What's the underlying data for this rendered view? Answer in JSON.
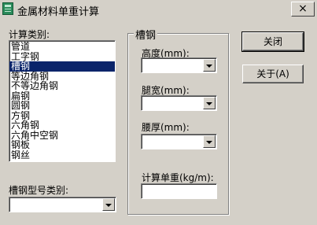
{
  "window": {
    "title": "金属材料单重计算",
    "close_glyph": "×"
  },
  "left": {
    "category_label": "计算类别:",
    "categories": [
      "管道",
      "工字钢",
      "槽钢",
      "等边角钢",
      "不等边角钢",
      "扁钢",
      "圆钢",
      "方钢",
      "六角钢",
      "六角中空钢",
      "钢板",
      "钢丝"
    ],
    "selected_category": "槽钢",
    "type_label": "槽钢型号类别:",
    "type_value": ""
  },
  "group": {
    "title": "槽钢",
    "height_label": "高度(mm):",
    "height_value": "",
    "width_label": "腿宽(mm):",
    "width_value": "",
    "thickness_label": "腰厚(mm):",
    "thickness_value": "",
    "unit_weight_label": "计算单重(kg/m):",
    "unit_weight_value": ""
  },
  "buttons": {
    "close_label": "关闭",
    "about_label": "关于(A)"
  }
}
